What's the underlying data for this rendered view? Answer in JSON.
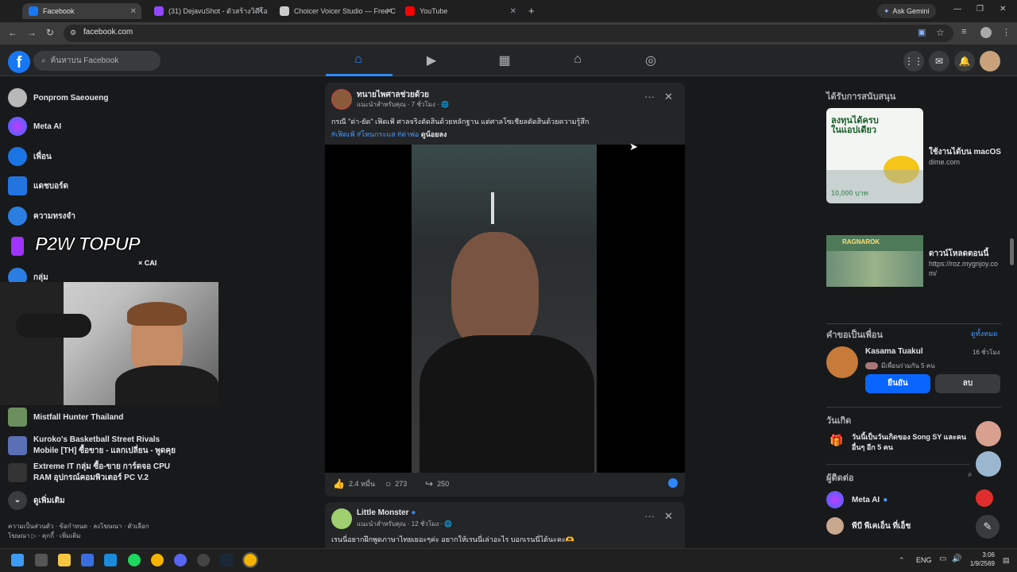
{
  "browser": {
    "tabs": [
      {
        "label": "Facebook",
        "active": true,
        "color": "#1877f2"
      },
      {
        "label": "(31) DejavuShot - ตัวสร้างวิดีโอ -",
        "active": false,
        "color": "#9146ff"
      },
      {
        "label": "Choicer Voicer Studio — Free C",
        "active": false,
        "color": "#cccccc"
      },
      {
        "label": "YouTube",
        "active": false,
        "color": "#ff0000"
      }
    ],
    "ask_gemini": "Ask Gemini",
    "url": "facebook.com"
  },
  "header": {
    "search_placeholder": "ค้นหาบน Facebook"
  },
  "left_nav": {
    "items": [
      {
        "label": "Ponprom Saeoueng"
      },
      {
        "label": "Meta AI"
      },
      {
        "label": "เพื่อน"
      },
      {
        "label": "แดชบอร์ด"
      },
      {
        "label": "ความทรงจำ"
      },
      {
        "label": "กลุ่ม"
      }
    ],
    "overlay_logo": "P2W TOPUP",
    "overlay_sub": "× CAI",
    "shortcuts": [
      {
        "label": "Mistfall Hunter Thailand"
      },
      {
        "label": "Kuroko's Basketball Street Rivals Mobile [TH] ซื้อขาย - แลกเปลี่ยน - พูดคุย"
      },
      {
        "label": "Extreme IT กลุ่ม ซื้อ-ขาย การ์ดจอ CPU RAM อุปกรณ์คอมพิวเตอร์ PC V.2"
      }
    ],
    "see_more": "ดูเพิ่มเติม",
    "footer": "ความเป็นส่วนตัว · ข้อกำหนด · ลงโฆษณา · ตัวเลือกโฆษณา ▷ · คุกกี้ · เพิ่มเติม"
  },
  "post": {
    "author": "ทนายไพศาลช่วยด้วย",
    "meta": "แนะนำสำหรับคุณ · 7 ชั่วโมง · 🌐",
    "text": "กรณี \"ด่า-ยัด\" เฟิดเฟ้ ศาลจริงตัดสินด้วยหลักฐาน แต่ศาลโซเชียลตัดสินด้วยความรู้สึก",
    "hashtags": "#เฟิดเฟ้ #โหนกระแส #ด่าพ่อ",
    "more": "ดูน้อยลง",
    "likes": "2.4 หมื่น",
    "comments": "273",
    "shares": "250"
  },
  "post2": {
    "author": "Little Monster",
    "meta": "แนะนำสำหรับคุณ · 12 ชั่วโมง · 🌐",
    "text": "เรนนี่อยากฝึกพูดภาษาไทยเยอะๆค่ะ อยากให้เรนนี่เล่าอะไร บอกเรนนี่ได้นะคะ🫶"
  },
  "right": {
    "sponsored_title": "ได้รับการสนับสนุน",
    "ads": [
      {
        "title": "ใช้งานได้บน macOS",
        "domain": "dime.com",
        "img_text": "ลงทุนได้ครบ ในแอปเดียว",
        "img_sub": "10,000 บาท"
      },
      {
        "title": "ดาวน์โหลดตอนนี้",
        "domain": "https://roz.mygnjoy.com/",
        "img_text": "RAGNAROK"
      }
    ],
    "friend_req_title": "คำขอเป็นเพื่อน",
    "see_all": "ดูทั้งหมด",
    "friend": {
      "name": "Kasama Tuakul",
      "time": "16 ชั่วโมง",
      "mutual": "มีเพื่อนร่วมกัน 5 คน",
      "confirm": "ยืนยัน",
      "delete": "ลบ"
    },
    "birthday_title": "วันเกิด",
    "birthday_text": "วันนี้เป็นวันเกิดของ Song SY และคนอื่นๆ อีก 5 คน",
    "contacts_title": "ผู้ติดต่อ",
    "contacts": [
      {
        "name": "Meta AI"
      },
      {
        "name": "พีบี พีเคเอ็น ที่เอ็ช"
      }
    ]
  },
  "taskbar": {
    "lang": "ENG",
    "time": "3:06",
    "date": "1/9/2569"
  }
}
